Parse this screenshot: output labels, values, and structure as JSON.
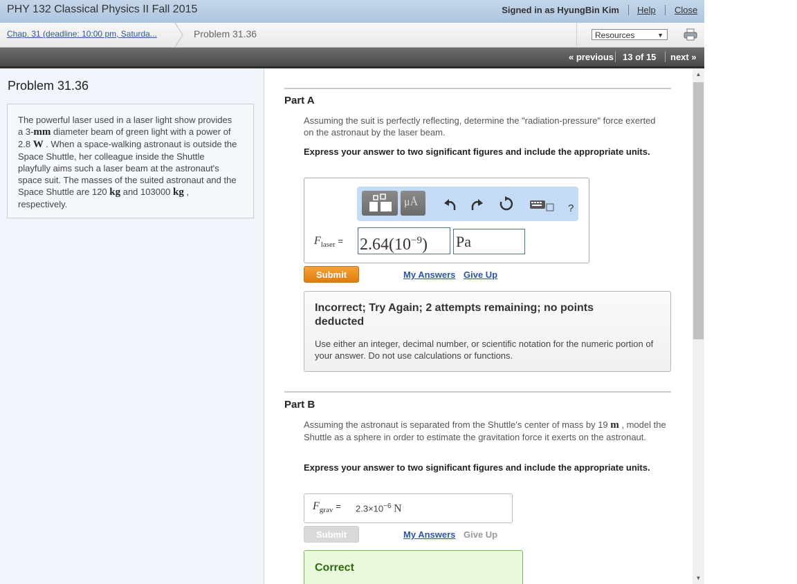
{
  "header": {
    "course_title": "PHY 132 Classical Physics II Fall 2015",
    "signed_in": "Signed in as HyungBin Kim",
    "help_label": "Help",
    "close_label": "Close"
  },
  "breadcrumb": {
    "chapter_link": "Chap. 31 (deadline: 10:00 pm, Saturda...",
    "current": "Problem 31.36",
    "resources_label": "Resources"
  },
  "nav": {
    "previous_label": "« previous",
    "counter": "13 of 15",
    "next_label": "next »"
  },
  "problem": {
    "title": "Problem 31.36",
    "statement": {
      "t1": "The powerful laser used in a laser light show provides a 3-",
      "unit1": "mm",
      "t2": " diameter beam of green light with a power of 2.8 ",
      "unit2": "W",
      "t3": " . When a space-walking astronaut is outside the Space Shuttle, her colleague inside the Shuttle playfully aims such a laser beam at the astronaut's space suit. The masses of the suited astronaut and the Space Shuttle are 120 ",
      "unit3": "kg",
      "t4": " and 103000 ",
      "unit4": "kg",
      "t5": " , respectively."
    }
  },
  "part_a": {
    "title": "Part A",
    "question": "Assuming the suit is perfectly reflecting, determine the \"radiation-pressure\" force exerted on the astronaut by the laser beam.",
    "instruction": "Express your answer to two significant figures and include the appropriate units.",
    "toolbar": {
      "units_button": "μÅ",
      "help": "?"
    },
    "var_symbol": "F",
    "var_subscript": "laser",
    "equals": "=",
    "value": "2.64(10",
    "value_exp": "−9",
    "value_close": ")",
    "unit": "Pa",
    "submit_label": "Submit",
    "my_answers": "My Answers",
    "give_up": "Give Up",
    "feedback": {
      "title": "Incorrect; Try Again; 2 attempts remaining; no points deducted",
      "text": "Use either an integer, decimal number, or scientific notation for the numeric portion of your answer. Do not use calculations or functions."
    }
  },
  "part_b": {
    "title": "Part B",
    "question_1": "Assuming the astronaut is separated from the Shuttle's center of mass by 19 ",
    "question_unit": "m",
    "question_2": " , model the Shuttle as a sphere in order to estimate the gravitation force it exerts on the astronaut.",
    "instruction": "Express your answer to two significant figures and include the appropriate units.",
    "var_symbol": "F",
    "var_subscript": "grav",
    "equals": "=",
    "answer_mantissa": "2.3×10",
    "answer_exp": "−6",
    "answer_unit": "N",
    "submit_label": "Submit",
    "my_answers": "My Answers",
    "give_up": "Give Up",
    "result": "Correct"
  },
  "colors": {
    "link": "#2a55a4",
    "submit_orange": "#e88a1a",
    "correct_green": "#2d6b0e"
  }
}
